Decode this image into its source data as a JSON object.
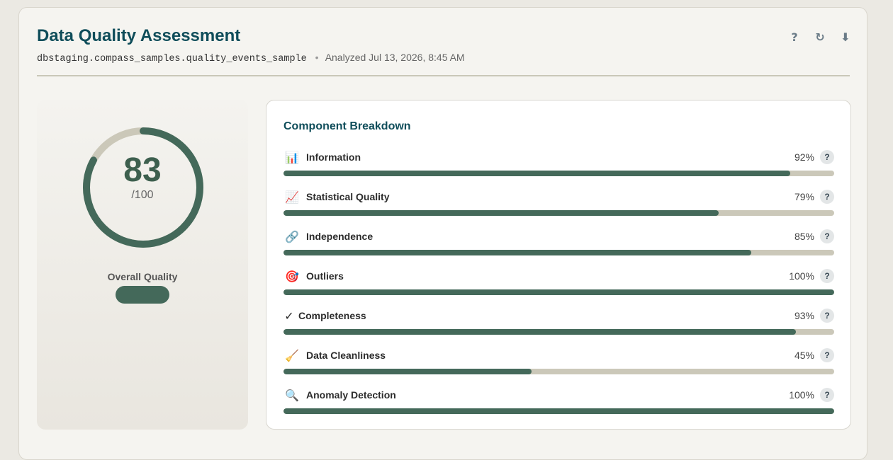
{
  "header": {
    "title": "Data Quality Assessment",
    "table_name": "dbstaging.compass_samples.quality_events_sample",
    "separator": "•",
    "analyzed": "Analyzed Jul 13, 2026, 8:45 AM",
    "tools": [
      {
        "name": "help-icon",
        "glyph": "?"
      },
      {
        "name": "refresh-icon",
        "glyph": "↻"
      },
      {
        "name": "download-icon",
        "glyph": "⬇"
      }
    ]
  },
  "score": {
    "value": "83",
    "max_label": "/100",
    "fraction": 0.83,
    "overall_label": "Overall Quality",
    "ring_color": "#44695a",
    "track_color": "#cbc8b9"
  },
  "breakdown": {
    "title": "Component Breakdown",
    "help_glyph": "?",
    "components": [
      {
        "label": "Information",
        "percent": "92%",
        "value": 0.92,
        "icon": "📊",
        "icon_name": "bar-chart-icon",
        "key": "information"
      },
      {
        "label": "Statistical Quality",
        "percent": "79%",
        "value": 0.79,
        "icon": "📈",
        "icon_name": "line-chart-icon",
        "key": "statistical-quality"
      },
      {
        "label": "Independence",
        "percent": "85%",
        "value": 0.85,
        "icon": "🔗",
        "icon_name": "link-icon",
        "key": "independence"
      },
      {
        "label": "Outliers",
        "percent": "100%",
        "value": 1.0,
        "icon": "🎯",
        "icon_name": "target-icon",
        "key": "outliers"
      },
      {
        "label": "Completeness",
        "percent": "93%",
        "value": 0.93,
        "icon": "✓",
        "icon_name": "checkmark-icon",
        "key": "completeness"
      },
      {
        "label": "Data Cleanliness",
        "percent": "45%",
        "value": 0.45,
        "icon": "🧹",
        "icon_name": "broom-icon",
        "key": "data-cleanliness"
      },
      {
        "label": "Anomaly Detection",
        "percent": "100%",
        "value": 1.0,
        "icon": "🔍",
        "icon_name": "magnifier-icon",
        "key": "anomaly-detection"
      }
    ]
  },
  "colors": {
    "accent": "#44695a",
    "title": "#0f4d5a",
    "track": "#cbc8b9"
  }
}
